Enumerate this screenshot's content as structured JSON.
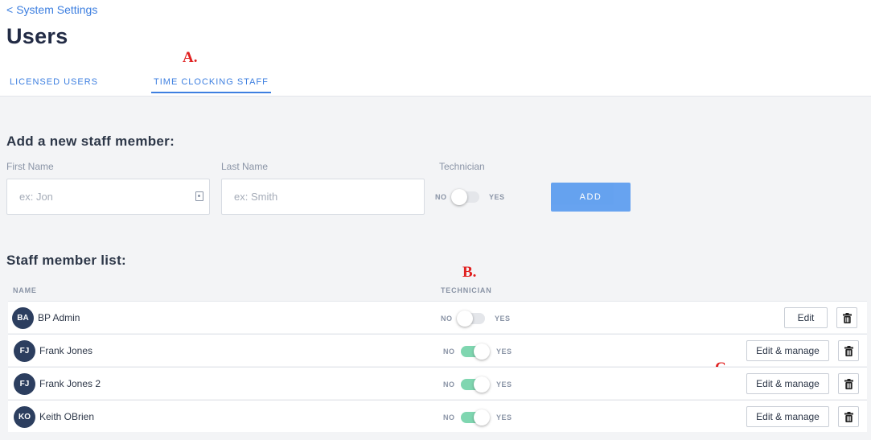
{
  "nav": {
    "back_label": "System Settings"
  },
  "page": {
    "title": "Users"
  },
  "annotations": {
    "a": "A.",
    "b": "B.",
    "c": "C."
  },
  "tabs": [
    {
      "label": "LICENSED USERS",
      "active": false
    },
    {
      "label": "TIME CLOCKING STAFF",
      "active": true
    }
  ],
  "add_form": {
    "title": "Add a new staff member:",
    "first_name": {
      "label": "First Name",
      "value": "",
      "placeholder": "ex: Jon"
    },
    "last_name": {
      "label": "Last Name",
      "value": "",
      "placeholder": "ex: Smith"
    },
    "technician": {
      "label": "Technician",
      "no": "NO",
      "yes": "YES",
      "checked": false
    },
    "add_label": "ADD"
  },
  "staff_list": {
    "title": "Staff member list:",
    "columns": {
      "name": "NAME",
      "technician": "TECHNICIAN"
    },
    "toggle_no": "NO",
    "toggle_yes": "YES",
    "rows": [
      {
        "initials": "BA",
        "name": "BP Admin",
        "technician": false,
        "action": "Edit"
      },
      {
        "initials": "FJ",
        "name": "Frank Jones",
        "technician": true,
        "action": "Edit & manage"
      },
      {
        "initials": "FJ",
        "name": "Frank Jones 2",
        "technician": true,
        "action": "Edit & manage"
      },
      {
        "initials": "KO",
        "name": "Keith OBrien",
        "technician": true,
        "action": "Edit & manage"
      }
    ],
    "delete_icon": "trash-icon"
  },
  "colors": {
    "accent": "#3d7fe0",
    "toggle_on": "#7fd6b0",
    "avatar": "#2c3e5f",
    "marker": "#e02020"
  }
}
